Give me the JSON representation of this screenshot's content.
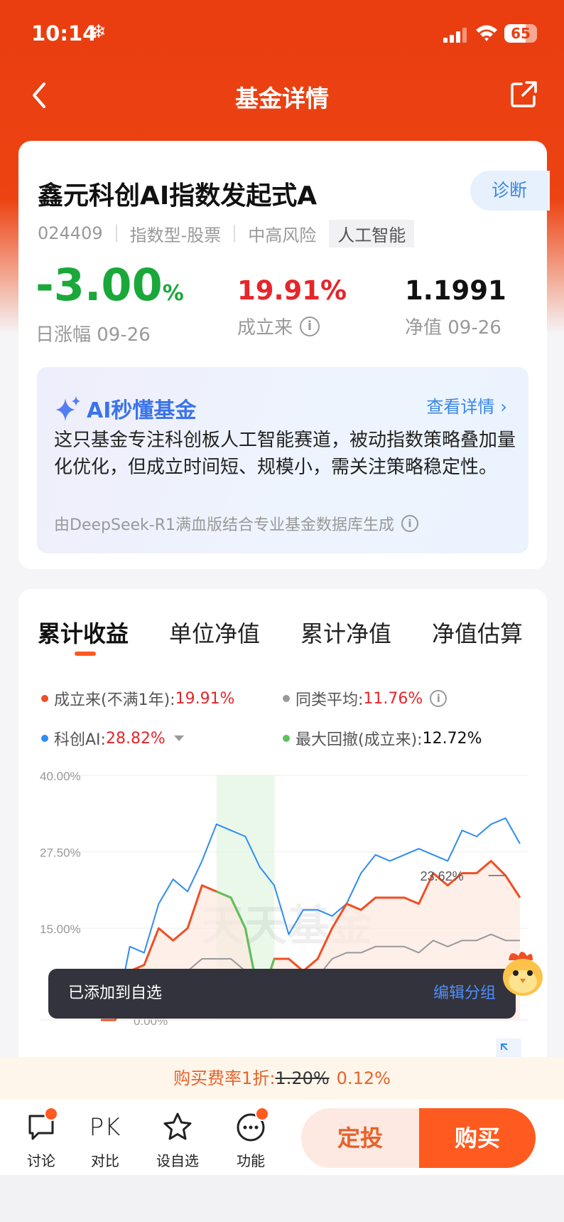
{
  "status_bar": {
    "time": "10:14",
    "weather_icon": "snowflake-icon",
    "battery": "65"
  },
  "nav": {
    "title": "基金详情",
    "back_icon": "chevron-left-icon",
    "share_icon": "share-icon"
  },
  "fund": {
    "name": "鑫元科创AI指数发起式A",
    "diagnose_label": "诊断",
    "code": "024409",
    "type": "指数型-股票",
    "risk": "中高风险",
    "tag": "人工智能",
    "daily_change": {
      "value": "-3.00",
      "unit": "%",
      "label": "日涨幅 09-26"
    },
    "since_inception": {
      "value": "19.91%",
      "label": "成立来"
    },
    "nav_value": {
      "value": "1.1991",
      "label": "净值 09-26"
    }
  },
  "ai": {
    "title": "AI秒懂基金",
    "more": "查看详情",
    "text": "这只基金专注科创板人工智能赛道，被动指数策略叠加量化优化，但成立时间短、规模小，需关注策略稳定性。",
    "footer": "由DeepSeek-R1满血版结合专业基金数据库生成"
  },
  "tabs": [
    "累计收益",
    "单位净值",
    "累计净值",
    "净值估算"
  ],
  "legend": [
    {
      "label": "成立来(不满1年):",
      "value": "19.91%",
      "color": "#f04e23"
    },
    {
      "label": "同类平均:",
      "value": "11.76%",
      "color": "#999999"
    },
    {
      "label": "科创AI:",
      "value": "28.82%",
      "color": "#2f8cf0"
    },
    {
      "label": "最大回撤(成立来):",
      "value": "12.72%",
      "color": "#5cc35c"
    }
  ],
  "chart_data": {
    "type": "line",
    "y_tick_labels": [
      "40.00%",
      "27.50%",
      "15.00%",
      "0.00%"
    ],
    "ylim": [
      0,
      40
    ],
    "x": [
      1,
      2,
      3,
      4,
      5,
      6,
      7,
      8,
      9,
      10,
      11,
      12,
      13,
      14,
      15,
      16,
      17,
      18,
      19,
      20,
      21,
      22,
      23,
      24,
      25,
      26,
      27,
      28,
      29,
      30
    ],
    "series": [
      {
        "name": "成立来",
        "color": "#f04e23",
        "values": [
          0,
          0,
          8,
          9,
          15,
          13,
          15,
          22,
          21,
          20,
          15,
          3,
          10,
          10,
          8,
          10,
          15,
          19,
          18,
          20,
          20,
          20,
          19,
          24,
          22,
          24,
          24,
          26,
          23.62,
          20
        ]
      },
      {
        "name": "同类平均",
        "color": "#999999",
        "values": [
          0,
          0,
          6,
          7,
          8,
          8,
          8,
          10,
          10,
          10,
          8,
          2,
          6,
          6,
          6,
          7,
          10,
          11,
          11,
          12,
          12,
          12,
          11,
          13,
          12,
          13,
          13,
          14,
          13,
          13
        ]
      },
      {
        "name": "科创AI",
        "color": "#2f8cf0",
        "values": [
          0,
          0,
          12,
          11,
          19,
          23,
          21,
          26,
          32,
          31,
          30,
          25,
          22,
          14,
          18,
          18,
          17,
          19,
          24,
          27,
          26,
          27,
          28,
          27,
          26,
          31,
          30,
          32,
          33,
          28.82
        ]
      }
    ],
    "annotation": "23.62%",
    "watermark": "天天基金",
    "grid": true
  },
  "toast": {
    "text": "已添加到自选",
    "action": "编辑分组"
  },
  "fee": {
    "prefix": "购买费率1折:",
    "original": "1.20%",
    "discount": "0.12%"
  },
  "bottom_bar": {
    "items": [
      {
        "label": "讨论",
        "icon": "chat-bubble-icon"
      },
      {
        "label": "对比",
        "icon_text": "PK"
      },
      {
        "label": "设自选",
        "icon": "star-icon"
      },
      {
        "label": "功能",
        "icon": "more-dots-icon"
      }
    ],
    "sip_label": "定投",
    "buy_label": "购买"
  }
}
